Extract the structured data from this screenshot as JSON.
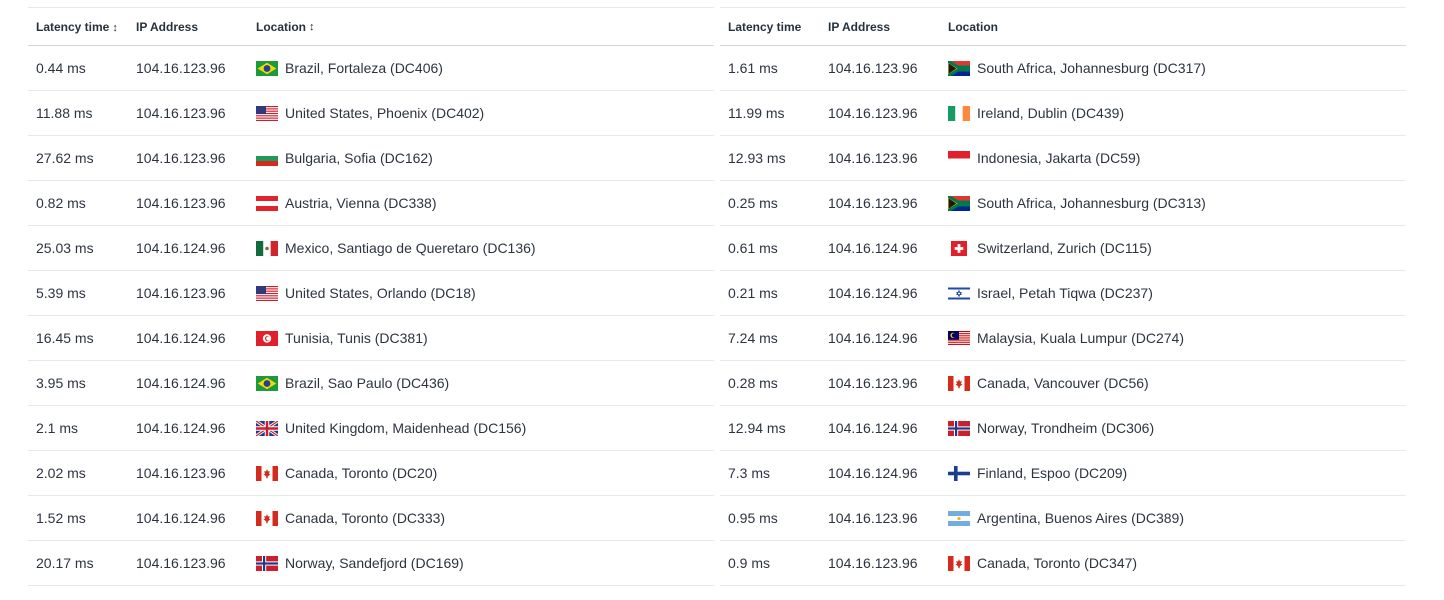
{
  "columns": {
    "left": {
      "latency": "Latency time",
      "ip": "IP Address",
      "location": "Location"
    },
    "right": {
      "latency": "Latency time",
      "ip": "IP Address",
      "location": "Location"
    }
  },
  "icons": {
    "sort": "sort-arrows-icon"
  },
  "left_rows": [
    {
      "latency": "0.44 ms",
      "ip": "104.16.123.96",
      "location": "Brazil, Fortaleza (DC406)",
      "flag": "BR"
    },
    {
      "latency": "11.88 ms",
      "ip": "104.16.123.96",
      "location": "United States, Phoenix (DC402)",
      "flag": "US"
    },
    {
      "latency": "27.62 ms",
      "ip": "104.16.123.96",
      "location": "Bulgaria, Sofia (DC162)",
      "flag": "BG"
    },
    {
      "latency": "0.82 ms",
      "ip": "104.16.123.96",
      "location": "Austria, Vienna (DC338)",
      "flag": "AT"
    },
    {
      "latency": "25.03 ms",
      "ip": "104.16.124.96",
      "location": "Mexico, Santiago de Queretaro (DC136)",
      "flag": "MX"
    },
    {
      "latency": "5.39 ms",
      "ip": "104.16.123.96",
      "location": "United States, Orlando (DC18)",
      "flag": "US"
    },
    {
      "latency": "16.45 ms",
      "ip": "104.16.124.96",
      "location": "Tunisia, Tunis (DC381)",
      "flag": "TN"
    },
    {
      "latency": "3.95 ms",
      "ip": "104.16.124.96",
      "location": "Brazil, Sao Paulo (DC436)",
      "flag": "BR"
    },
    {
      "latency": "2.1 ms",
      "ip": "104.16.124.96",
      "location": "United Kingdom, Maidenhead (DC156)",
      "flag": "GB"
    },
    {
      "latency": "2.02 ms",
      "ip": "104.16.123.96",
      "location": "Canada, Toronto (DC20)",
      "flag": "CA"
    },
    {
      "latency": "1.52 ms",
      "ip": "104.16.124.96",
      "location": "Canada, Toronto (DC333)",
      "flag": "CA"
    },
    {
      "latency": "20.17 ms",
      "ip": "104.16.123.96",
      "location": "Norway, Sandefjord (DC169)",
      "flag": "NO"
    }
  ],
  "right_rows": [
    {
      "latency": "1.61 ms",
      "ip": "104.16.123.96",
      "location": "South Africa, Johannesburg (DC317)",
      "flag": "ZA"
    },
    {
      "latency": "11.99 ms",
      "ip": "104.16.123.96",
      "location": "Ireland, Dublin (DC439)",
      "flag": "IE"
    },
    {
      "latency": "12.93 ms",
      "ip": "104.16.123.96",
      "location": "Indonesia, Jakarta (DC59)",
      "flag": "ID"
    },
    {
      "latency": "0.25 ms",
      "ip": "104.16.123.96",
      "location": "South Africa, Johannesburg (DC313)",
      "flag": "ZA"
    },
    {
      "latency": "0.61 ms",
      "ip": "104.16.124.96",
      "location": "Switzerland, Zurich (DC115)",
      "flag": "CH"
    },
    {
      "latency": "0.21 ms",
      "ip": "104.16.124.96",
      "location": "Israel, Petah Tiqwa (DC237)",
      "flag": "IL"
    },
    {
      "latency": "7.24 ms",
      "ip": "104.16.124.96",
      "location": "Malaysia, Kuala Lumpur (DC274)",
      "flag": "MY"
    },
    {
      "latency": "0.28 ms",
      "ip": "104.16.123.96",
      "location": "Canada, Vancouver (DC56)",
      "flag": "CA"
    },
    {
      "latency": "12.94 ms",
      "ip": "104.16.124.96",
      "location": "Norway, Trondheim (DC306)",
      "flag": "NO"
    },
    {
      "latency": "7.3 ms",
      "ip": "104.16.124.96",
      "location": "Finland, Espoo (DC209)",
      "flag": "FI"
    },
    {
      "latency": "0.95 ms",
      "ip": "104.16.123.96",
      "location": "Argentina, Buenos Aires (DC389)",
      "flag": "AR"
    },
    {
      "latency": "0.9 ms",
      "ip": "104.16.123.96",
      "location": "Canada, Toronto (DC347)",
      "flag": "CA"
    }
  ]
}
